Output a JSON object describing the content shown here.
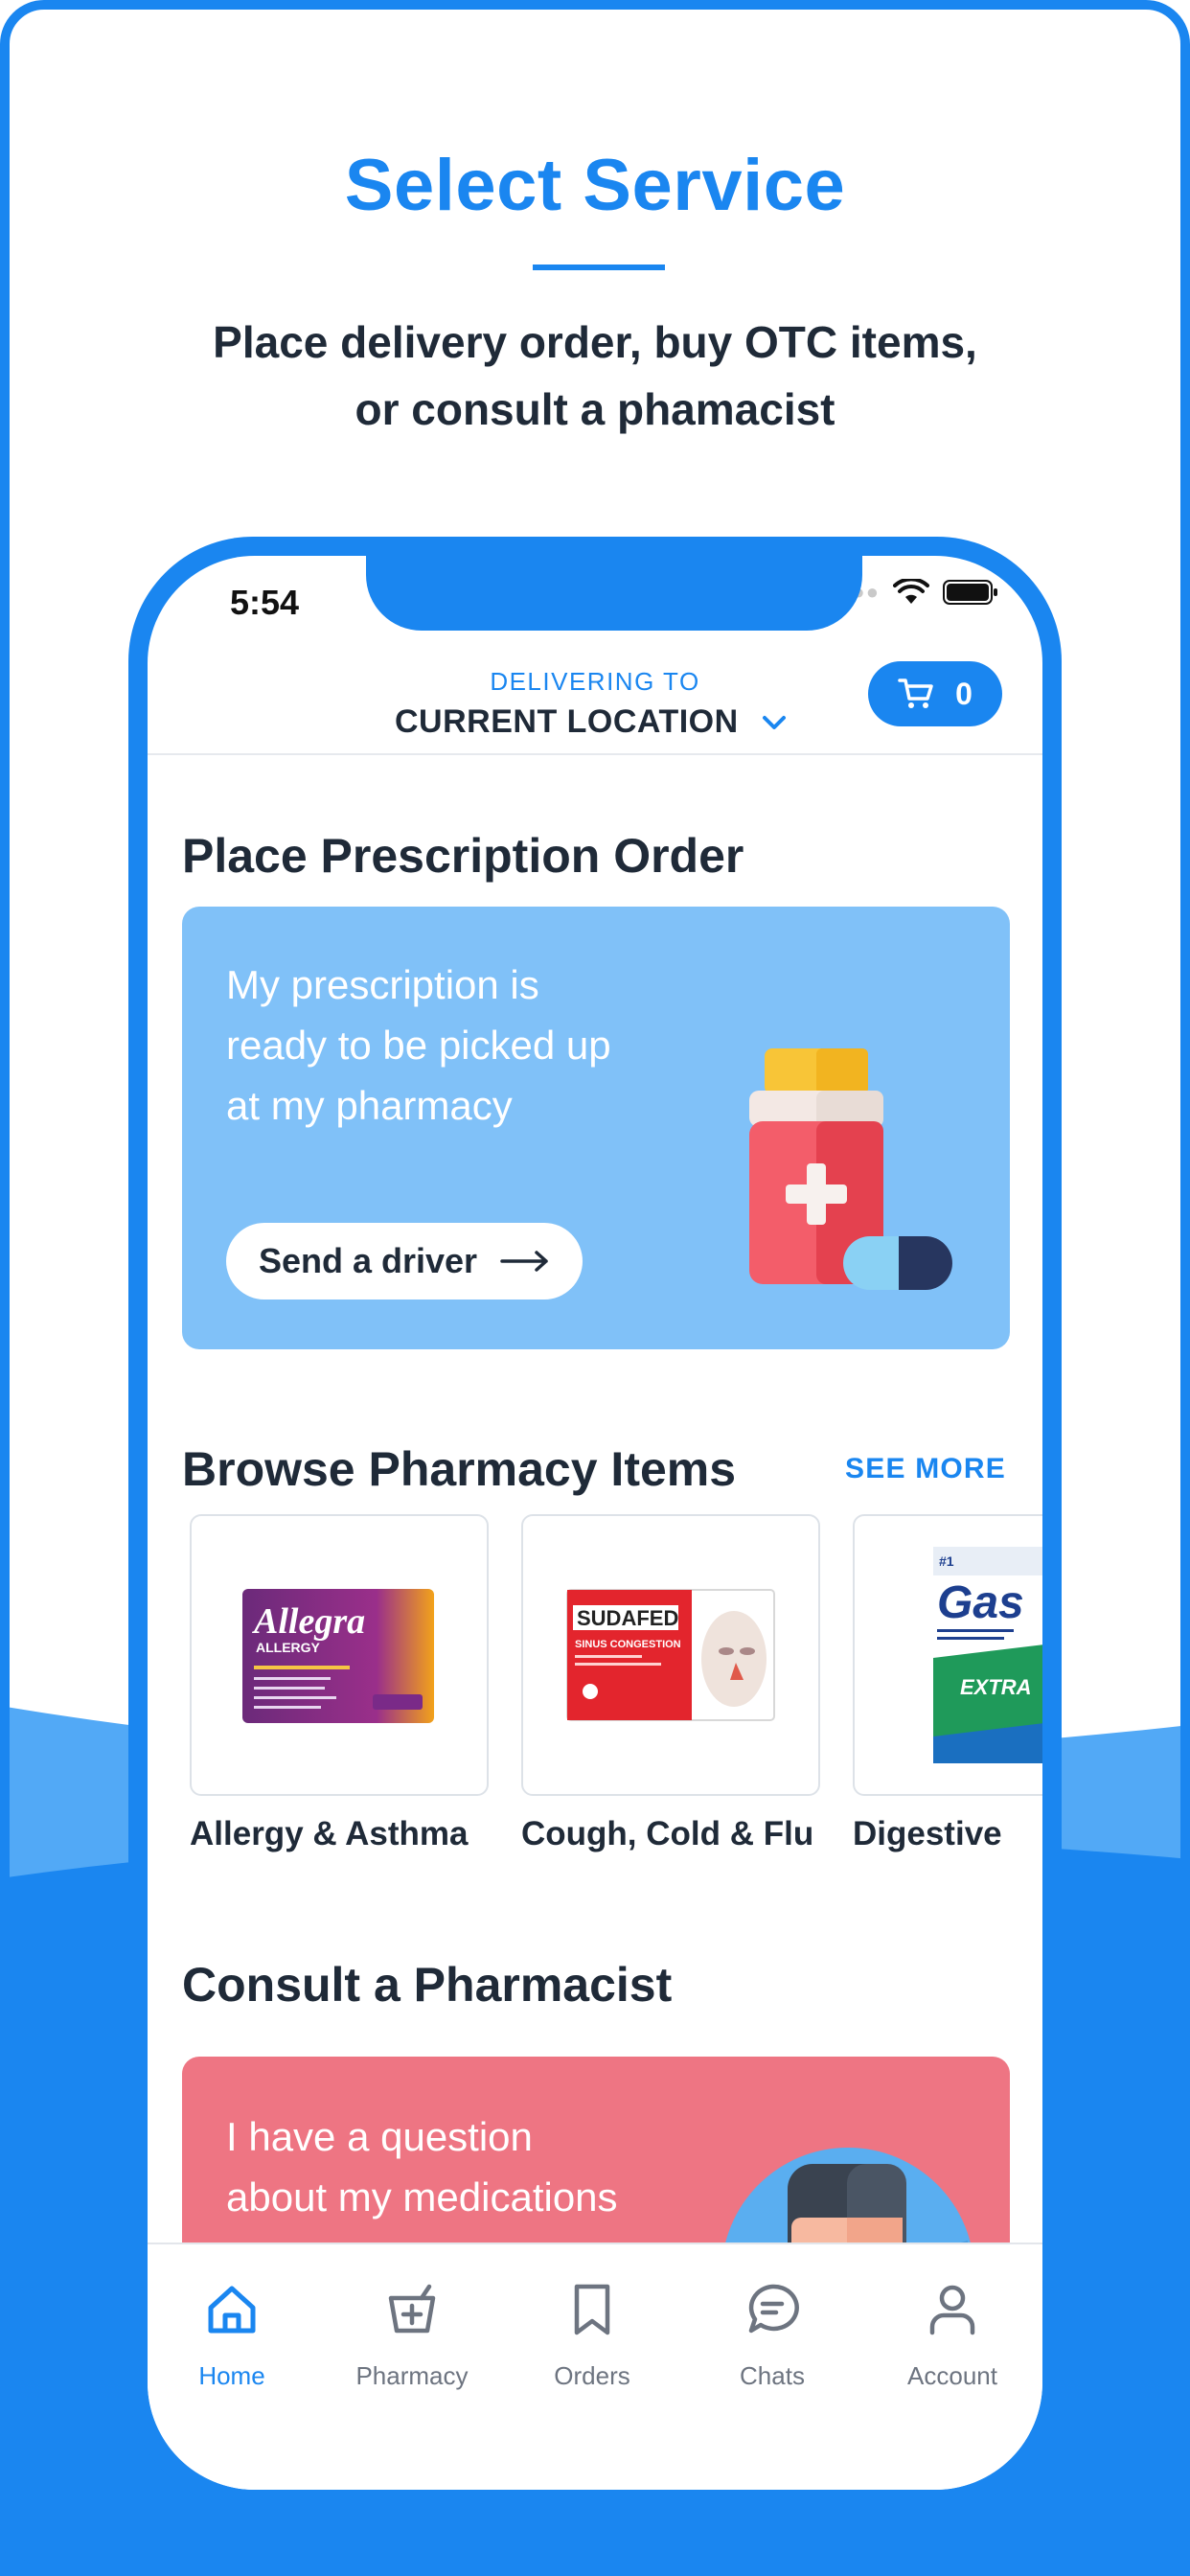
{
  "promo": {
    "title": "Select Service",
    "subtitle_line1": "Place delivery order, buy OTC items,",
    "subtitle_line2": "or consult a phamacist"
  },
  "status_bar": {
    "time": "5:54"
  },
  "header": {
    "delivering_label": "DELIVERING TO",
    "location": "CURRENT LOCATION",
    "cart_count": "0"
  },
  "prescription": {
    "section_title": "Place Prescription Order",
    "card_line1": "My prescription is",
    "card_line2": "ready to be picked up",
    "card_line3": "at my pharmacy",
    "button_label": "Send a driver"
  },
  "browse": {
    "section_title": "Browse Pharmacy Items",
    "see_more": "SEE MORE",
    "items": [
      {
        "label": "Allergy & Asthma",
        "product_brand": "Allegra",
        "product_sub": "ALLERGY"
      },
      {
        "label": "Cough, Cold & Flu",
        "product_brand": "SUDAFED",
        "product_sub": "SINUS CONGESTION"
      },
      {
        "label": "Digestive",
        "product_brand": "Gas",
        "product_sub": "EXTRA"
      }
    ]
  },
  "consult": {
    "section_title": "Consult a Pharmacist",
    "card_line1": "I have a question",
    "card_line2": "about my medications"
  },
  "tabbar": {
    "tabs": [
      {
        "label": "Home",
        "icon": "home-icon",
        "active": true
      },
      {
        "label": "Pharmacy",
        "icon": "pharmacy-icon",
        "active": false
      },
      {
        "label": "Orders",
        "icon": "bookmark-icon",
        "active": false
      },
      {
        "label": "Chats",
        "icon": "chat-icon",
        "active": false
      },
      {
        "label": "Account",
        "icon": "person-icon",
        "active": false
      }
    ]
  },
  "colors": {
    "accent": "#1a86f0",
    "rx_card": "#80c1f8",
    "consult_card": "#ee7583",
    "text_dark": "#1f2a38"
  }
}
